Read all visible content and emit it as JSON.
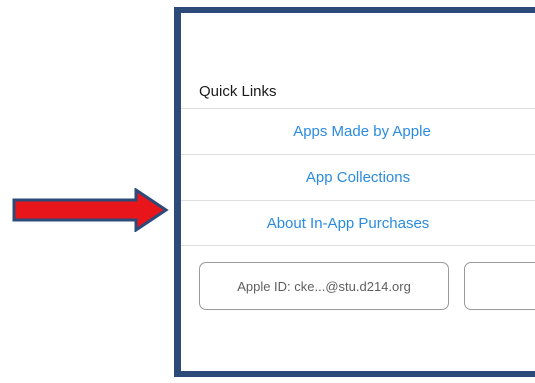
{
  "quick_links": {
    "title": "Quick Links",
    "items": [
      {
        "label": "Apps Made by Apple"
      },
      {
        "label": "App Collections"
      },
      {
        "label": "About In-App Purchases"
      }
    ]
  },
  "account": {
    "apple_id_label": "Apple ID: cke...@stu.d214.org"
  },
  "colors": {
    "frame_border": "#2c4a7a",
    "link": "#2a8be0",
    "arrow_fill": "#e8151b",
    "arrow_outline": "#2c4a7a"
  },
  "icons": {
    "annotation_arrow": "right-arrow-icon"
  }
}
